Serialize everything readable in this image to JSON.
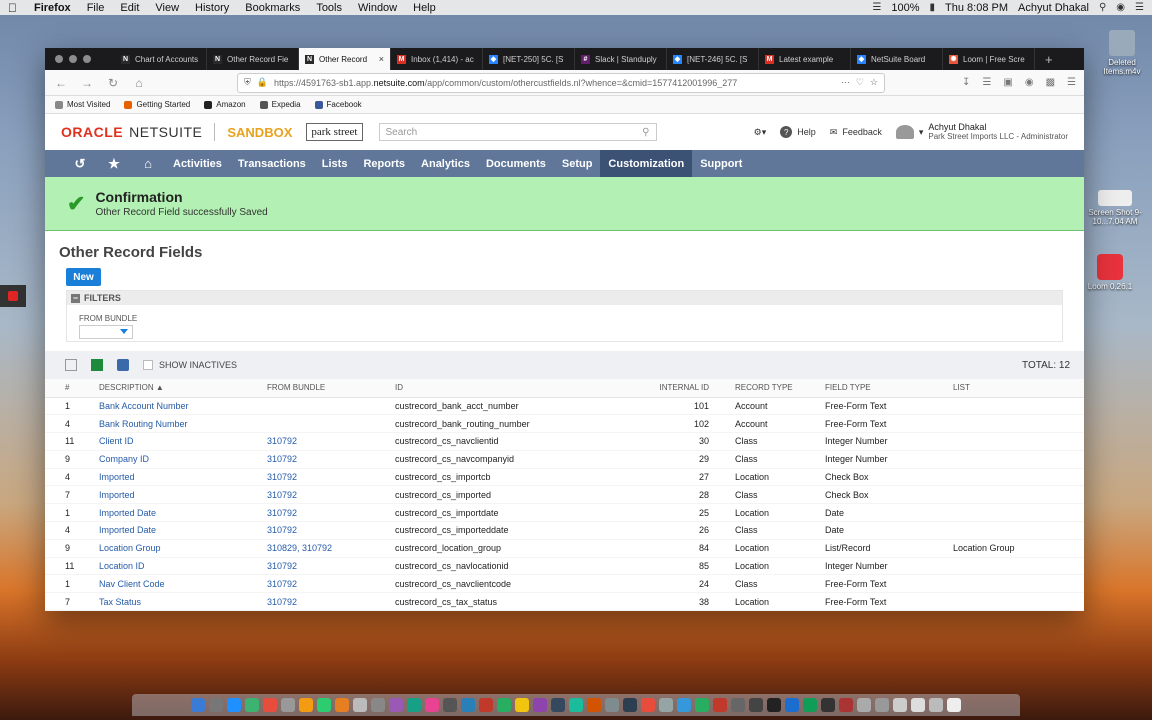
{
  "menubar": {
    "app": "Firefox",
    "items": [
      "File",
      "Edit",
      "View",
      "History",
      "Bookmarks",
      "Tools",
      "Window",
      "Help"
    ],
    "battery": "100%",
    "clock": "Thu 8:08 PM",
    "user": "Achyut Dhakal"
  },
  "desktop": {
    "deleted_label": "Deleted Items.m4v",
    "screenshot_label": "Screen Shot 9-10...7.04 AM",
    "loom_label": "Loom 0.26.1"
  },
  "browser": {
    "tabs": [
      {
        "label": "Chart of Accounts",
        "color": "#2a2a2a",
        "glyph": "N"
      },
      {
        "label": "Other Record Fie",
        "color": "#2a2a2a",
        "glyph": "N"
      },
      {
        "label": "Other Record",
        "color": "#2a2a2a",
        "glyph": "N",
        "active": true
      },
      {
        "label": "Inbox (1,414) - ac",
        "color": "#d93025",
        "glyph": "M"
      },
      {
        "label": "[NET-250] 5C. [S",
        "color": "#2684ff",
        "glyph": "◆"
      },
      {
        "label": "Slack | Standuply",
        "color": "#611f69",
        "glyph": "#"
      },
      {
        "label": "[NET-246] 5C. [S",
        "color": "#2684ff",
        "glyph": "◆"
      },
      {
        "label": "Latest example",
        "color": "#d93025",
        "glyph": "M"
      },
      {
        "label": "NetSuite Board",
        "color": "#2684ff",
        "glyph": "◆"
      },
      {
        "label": "Loom | Free Scre",
        "color": "#e8563b",
        "glyph": "✺"
      }
    ],
    "url_prefix": "https://4591763-sb1.app.",
    "url_domain": "netsuite.com",
    "url_suffix": "/app/common/custom/othercustfields.nl?whence=&cmid=1577412001996_277",
    "bookmarks": [
      {
        "label": "Most Visited",
        "color": "#888"
      },
      {
        "label": "Getting Started",
        "color": "#e66000"
      },
      {
        "label": "Amazon",
        "color": "#222"
      },
      {
        "label": "Expedia",
        "color": "#555"
      },
      {
        "label": "Facebook",
        "color": "#3b5998"
      }
    ]
  },
  "netsuite": {
    "brand_oracle": "ORACLE",
    "brand_netsuite": "NETSUITE",
    "sandbox": "SANDBOX",
    "company_logo": "park street",
    "search_placeholder": "Search",
    "help": "Help",
    "feedback": "Feedback",
    "user_name": "Achyut Dhakal",
    "user_role": "Park Street Imports LLC - Administrator",
    "nav": [
      "Activities",
      "Transactions",
      "Lists",
      "Reports",
      "Analytics",
      "Documents",
      "Setup",
      "Customization",
      "Support"
    ],
    "nav_active": "Customization",
    "confirmation_title": "Confirmation",
    "confirmation_message": "Other Record Field successfully Saved",
    "page_title": "Other Record Fields",
    "new_button": "New",
    "filters_label": "FILTERS",
    "from_bundle_label": "FROM BUNDLE",
    "show_inactives": "SHOW INACTIVES",
    "total": "TOTAL: 12",
    "columns": [
      "#",
      "DESCRIPTION ▲",
      "FROM BUNDLE",
      "ID",
      "INTERNAL ID",
      "RECORD TYPE",
      "FIELD TYPE",
      "LIST"
    ],
    "rows": [
      {
        "n": "1",
        "desc": "Bank Account Number",
        "bundle": "",
        "id": "custrecord_bank_acct_number",
        "iid": "101",
        "rtype": "Account",
        "ftype": "Free-Form Text",
        "list": ""
      },
      {
        "n": "4",
        "desc": "Bank Routing Number",
        "bundle": "",
        "id": "custrecord_bank_routing_number",
        "iid": "102",
        "rtype": "Account",
        "ftype": "Free-Form Text",
        "list": ""
      },
      {
        "n": "11",
        "desc": "Client ID",
        "bundle": "310792",
        "id": "custrecord_cs_navclientid",
        "iid": "30",
        "rtype": "Class",
        "ftype": "Integer Number",
        "list": ""
      },
      {
        "n": "9",
        "desc": "Company ID",
        "bundle": "310792",
        "id": "custrecord_cs_navcompanyid",
        "iid": "29",
        "rtype": "Class",
        "ftype": "Integer Number",
        "list": ""
      },
      {
        "n": "4",
        "desc": "Imported",
        "bundle": "310792",
        "id": "custrecord_cs_importcb",
        "iid": "27",
        "rtype": "Location",
        "ftype": "Check Box",
        "list": ""
      },
      {
        "n": "7",
        "desc": "Imported",
        "bundle": "310792",
        "id": "custrecord_cs_imported",
        "iid": "28",
        "rtype": "Class",
        "ftype": "Check Box",
        "list": ""
      },
      {
        "n": "1",
        "desc": "Imported Date",
        "bundle": "310792",
        "id": "custrecord_cs_importdate",
        "iid": "25",
        "rtype": "Location",
        "ftype": "Date",
        "list": ""
      },
      {
        "n": "4",
        "desc": "Imported Date",
        "bundle": "310792",
        "id": "custrecord_cs_importeddate",
        "iid": "26",
        "rtype": "Class",
        "ftype": "Date",
        "list": ""
      },
      {
        "n": "9",
        "desc": "Location Group",
        "bundle": "310829, 310792",
        "id": "custrecord_location_group",
        "iid": "84",
        "rtype": "Location",
        "ftype": "List/Record",
        "list": "Location Group"
      },
      {
        "n": "11",
        "desc": "Location ID",
        "bundle": "310792",
        "id": "custrecord_cs_navlocationid",
        "iid": "85",
        "rtype": "Location",
        "ftype": "Integer Number",
        "list": ""
      },
      {
        "n": "1",
        "desc": "Nav Client Code",
        "bundle": "310792",
        "id": "custrecord_cs_navclientcode",
        "iid": "24",
        "rtype": "Class",
        "ftype": "Free-Form Text",
        "list": ""
      },
      {
        "n": "7",
        "desc": "Tax Status",
        "bundle": "310792",
        "id": "custrecord_cs_tax_status",
        "iid": "38",
        "rtype": "Location",
        "ftype": "Free-Form Text",
        "list": ""
      }
    ]
  },
  "colors": {
    "nav_bg": "#607799",
    "nav_active": "#3c5274",
    "confirm_bg": "#b3f0b3",
    "link": "#255ba8",
    "new_button": "#1a7fd9",
    "oracle_red": "#e0311f",
    "sandbox_orange": "#e8a21b"
  },
  "icons": {
    "menubar": [
      "apple-icon",
      "wifi-icon",
      "battery-icon",
      "search-icon",
      "siri-icon"
    ],
    "nav": [
      "recent-icon",
      "star-icon",
      "home-icon"
    ]
  },
  "dock_colors": [
    "#3a7bd5",
    "#777",
    "#1e90ff",
    "#3cb371",
    "#e74c3c",
    "#999",
    "#f39c12",
    "#2ecc71",
    "#e67e22",
    "#bbb",
    "#888",
    "#9b59b6",
    "#16a085",
    "#e84393",
    "#555",
    "#2980b9",
    "#c0392b",
    "#27ae60",
    "#f1c40f",
    "#8e44ad",
    "#34495e",
    "#1abc9c",
    "#d35400",
    "#7f8c8d",
    "#2c3e50",
    "#e74c3c",
    "#95a5a6",
    "#3498db",
    "#27ae60",
    "#c0392b",
    "#666",
    "#444",
    "#222",
    "#1c6dd0",
    "#0f9d58",
    "#333",
    "#a33",
    "#aaa",
    "#999",
    "#ccc",
    "#ddd",
    "#bbb",
    "#eee"
  ]
}
